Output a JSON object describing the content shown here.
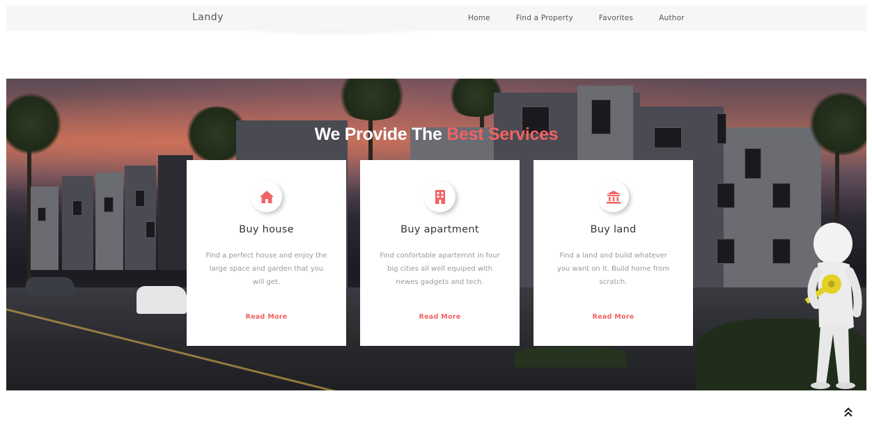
{
  "navbar": {
    "brand": "Landy",
    "links": [
      "Home",
      "Find a Property",
      "Favorites",
      "Author"
    ]
  },
  "hero": {
    "title_plain": "We Provide The ",
    "title_accent": "Best Services",
    "cards": [
      {
        "icon": "home-icon",
        "title": "Buy house",
        "text": "Find a perfect house and enjoy the large space and garden that you will get.",
        "link": "Read More"
      },
      {
        "icon": "building-icon",
        "title": "Buy apartment",
        "text": "Find confortable apartemnt in four big cities all well equiped with newes gadgets and tech.",
        "link": "Read More"
      },
      {
        "icon": "bank-icon",
        "title": "Buy land",
        "text": "Find a land and build whatever you want on it. Build home from scratch.",
        "link": "Read More"
      }
    ]
  },
  "scroll_top": {
    "icon": "double-chevron-up-icon",
    "glyph": "⌃"
  },
  "colors": {
    "accent": "#f26262",
    "navbar_bg": "#f5f6f8",
    "card_bg": "#ffffff",
    "text_muted": "#999999"
  }
}
